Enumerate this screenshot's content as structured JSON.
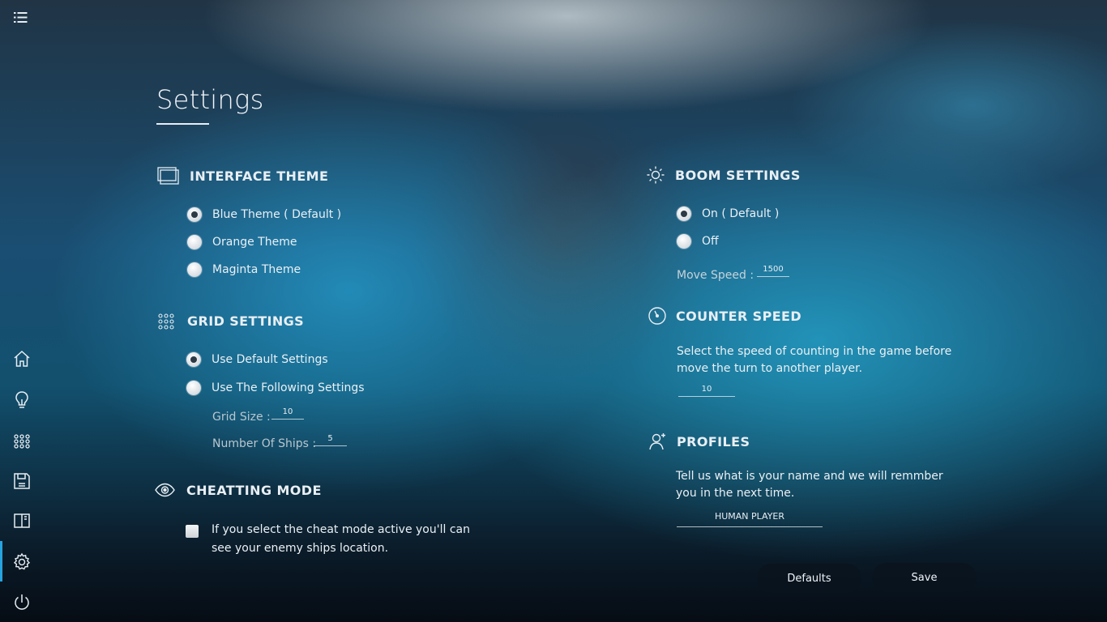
{
  "page": {
    "title": "Settings"
  },
  "sidebar": {
    "items": [
      {
        "name": "home",
        "icon": "home-icon"
      },
      {
        "name": "tips",
        "icon": "lightbulb-icon"
      },
      {
        "name": "grid",
        "icon": "grid-dots-icon"
      },
      {
        "name": "save",
        "icon": "save-icon"
      },
      {
        "name": "book",
        "icon": "book-icon"
      },
      {
        "name": "settings",
        "icon": "gear-icon",
        "active": true
      },
      {
        "name": "power",
        "icon": "power-icon"
      }
    ],
    "accent_color": "#27a3e0"
  },
  "interface_theme": {
    "title": "INTERFACE THEME",
    "options": [
      {
        "label": "Blue Theme  ( Default )",
        "checked": true
      },
      {
        "label": "Orange Theme",
        "checked": false
      },
      {
        "label": "Maginta Theme",
        "checked": false
      }
    ]
  },
  "grid_settings": {
    "title": "GRID SETTINGS",
    "options": [
      {
        "label": "Use Default Settings",
        "checked": true
      },
      {
        "label": "Use The Following Settings",
        "checked": false
      }
    ],
    "grid_size_label": "Grid Size :",
    "grid_size_value": "10",
    "ships_label": "Number Of Ships :",
    "ships_value": "5"
  },
  "cheat_mode": {
    "title": "CHEATTING MODE",
    "description_line1": "If you select the cheat mode active you'll can",
    "description_line2": "see your enemy ships location.",
    "checked": false
  },
  "boom_settings": {
    "title": "BOOM SETTINGS",
    "options": [
      {
        "label": "On  ( Default )",
        "checked": true
      },
      {
        "label": "Off",
        "checked": false
      }
    ],
    "move_speed_label": "Move Speed :",
    "move_speed_value": "1500"
  },
  "counter_speed": {
    "title": "COUNTER SPEED",
    "description_line1": "Select the speed of counting in the game before",
    "description_line2": "move the turn to another player.",
    "value": "10"
  },
  "profiles": {
    "title": "PROFILES",
    "description_line1": "Tell us what is your name and we will remmber",
    "description_line2": "you in the next time.",
    "name_value": "HUMAN PLAYER"
  },
  "actions": {
    "defaults_label": "Defaults",
    "save_label": "Save"
  }
}
